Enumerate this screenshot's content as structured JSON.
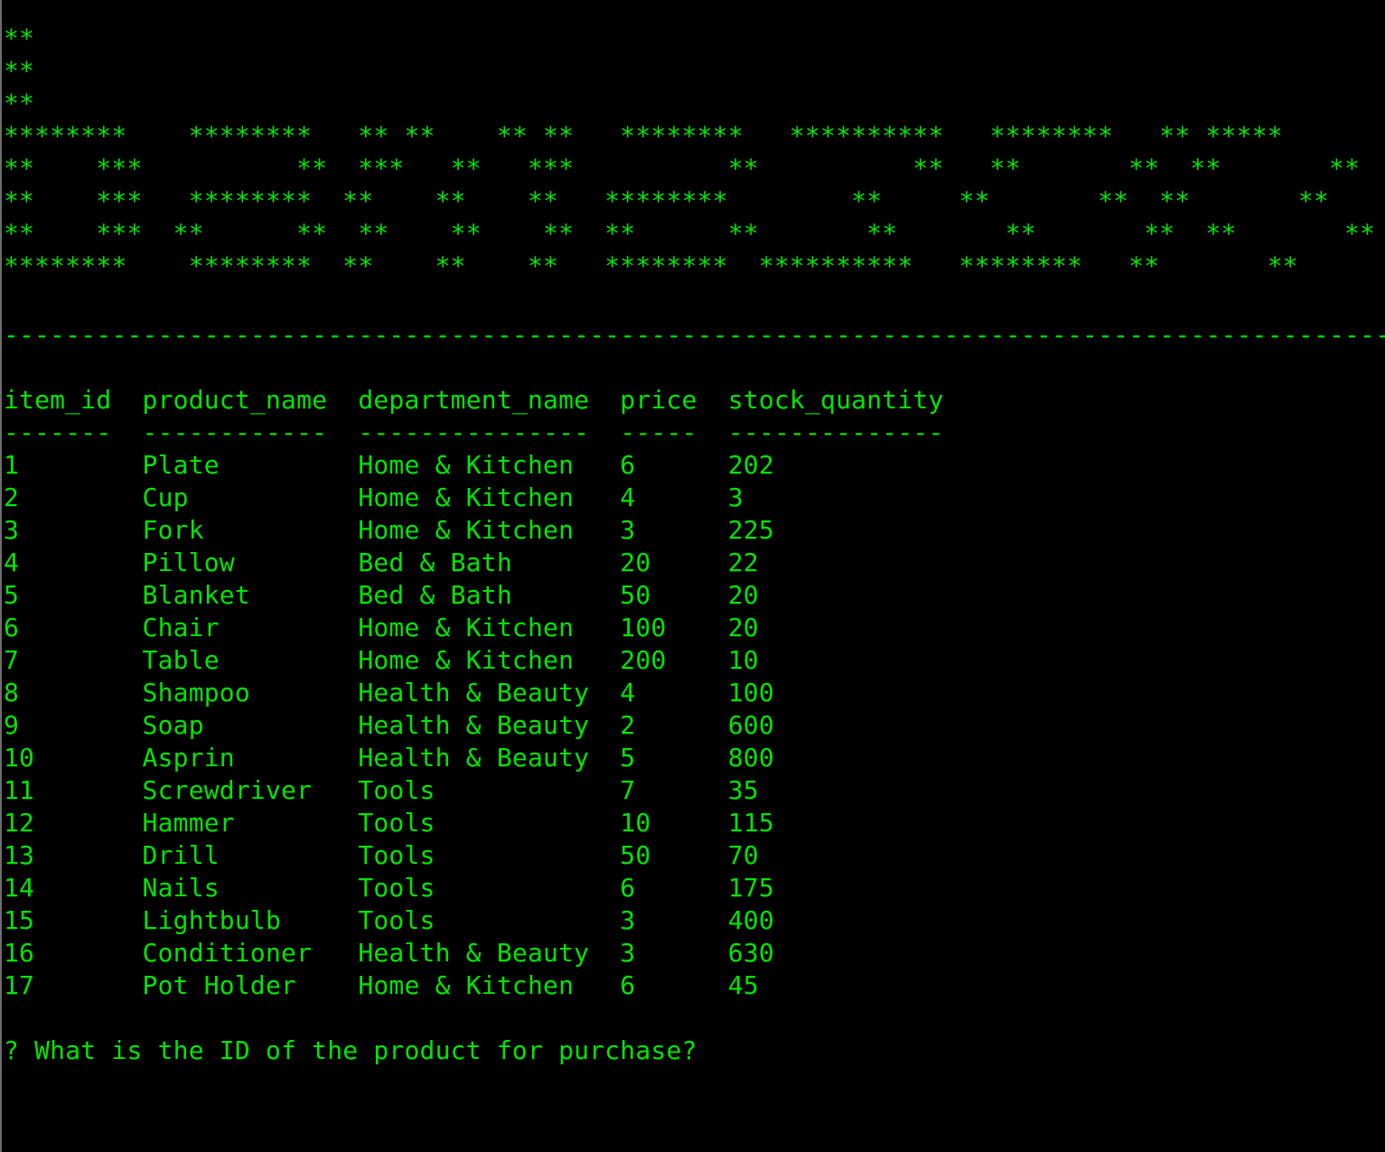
{
  "theme": {
    "background": "#000000",
    "text_color": "#00e600",
    "border_color": "#6e6e6e"
  },
  "banner": [
    "**",
    "**",
    "**",
    "********    ********   ** **    ** **   ********   **********   ********   ** *****",
    "**    ***          **  ***   **   ***          **          **   **       **  **       **",
    "**    ***   ********  **    **    **   ********        **     **       **  **       **",
    "**    ***  **      **  **    **    **  **      **       **       **       **  **       **",
    "********    ********  **    **    **   ********  **********   ********   **       **"
  ],
  "separator": "------------------------------------------------------------------------------------------",
  "table": {
    "header": "item_id  product_name  department_name  price  stock_quantity",
    "underline": "-------  ------------  ---------------  -----  --------------",
    "rows": [
      "1        Plate         Home & Kitchen   6      202",
      "2        Cup           Home & Kitchen   4      3",
      "3        Fork          Home & Kitchen   3      225",
      "4        Pillow        Bed & Bath       20     22",
      "5        Blanket       Bed & Bath       50     20",
      "6        Chair         Home & Kitchen   100    20",
      "7        Table         Home & Kitchen   200    10",
      "8        Shampoo       Health & Beauty  4      100",
      "9        Soap          Health & Beauty  2      600",
      "10       Asprin        Health & Beauty  5      800",
      "11       Screwdriver   Tools            7      35",
      "12       Hammer        Tools            10     115",
      "13       Drill         Tools            50     70",
      "14       Nails         Tools            6      175",
      "15       Lightbulb     Tools            3      400",
      "16       Conditioner   Health & Beauty  3      630",
      "17       Pot Holder    Home & Kitchen   6      45"
    ]
  },
  "prompt": "? What is the ID of the product for purchase?"
}
